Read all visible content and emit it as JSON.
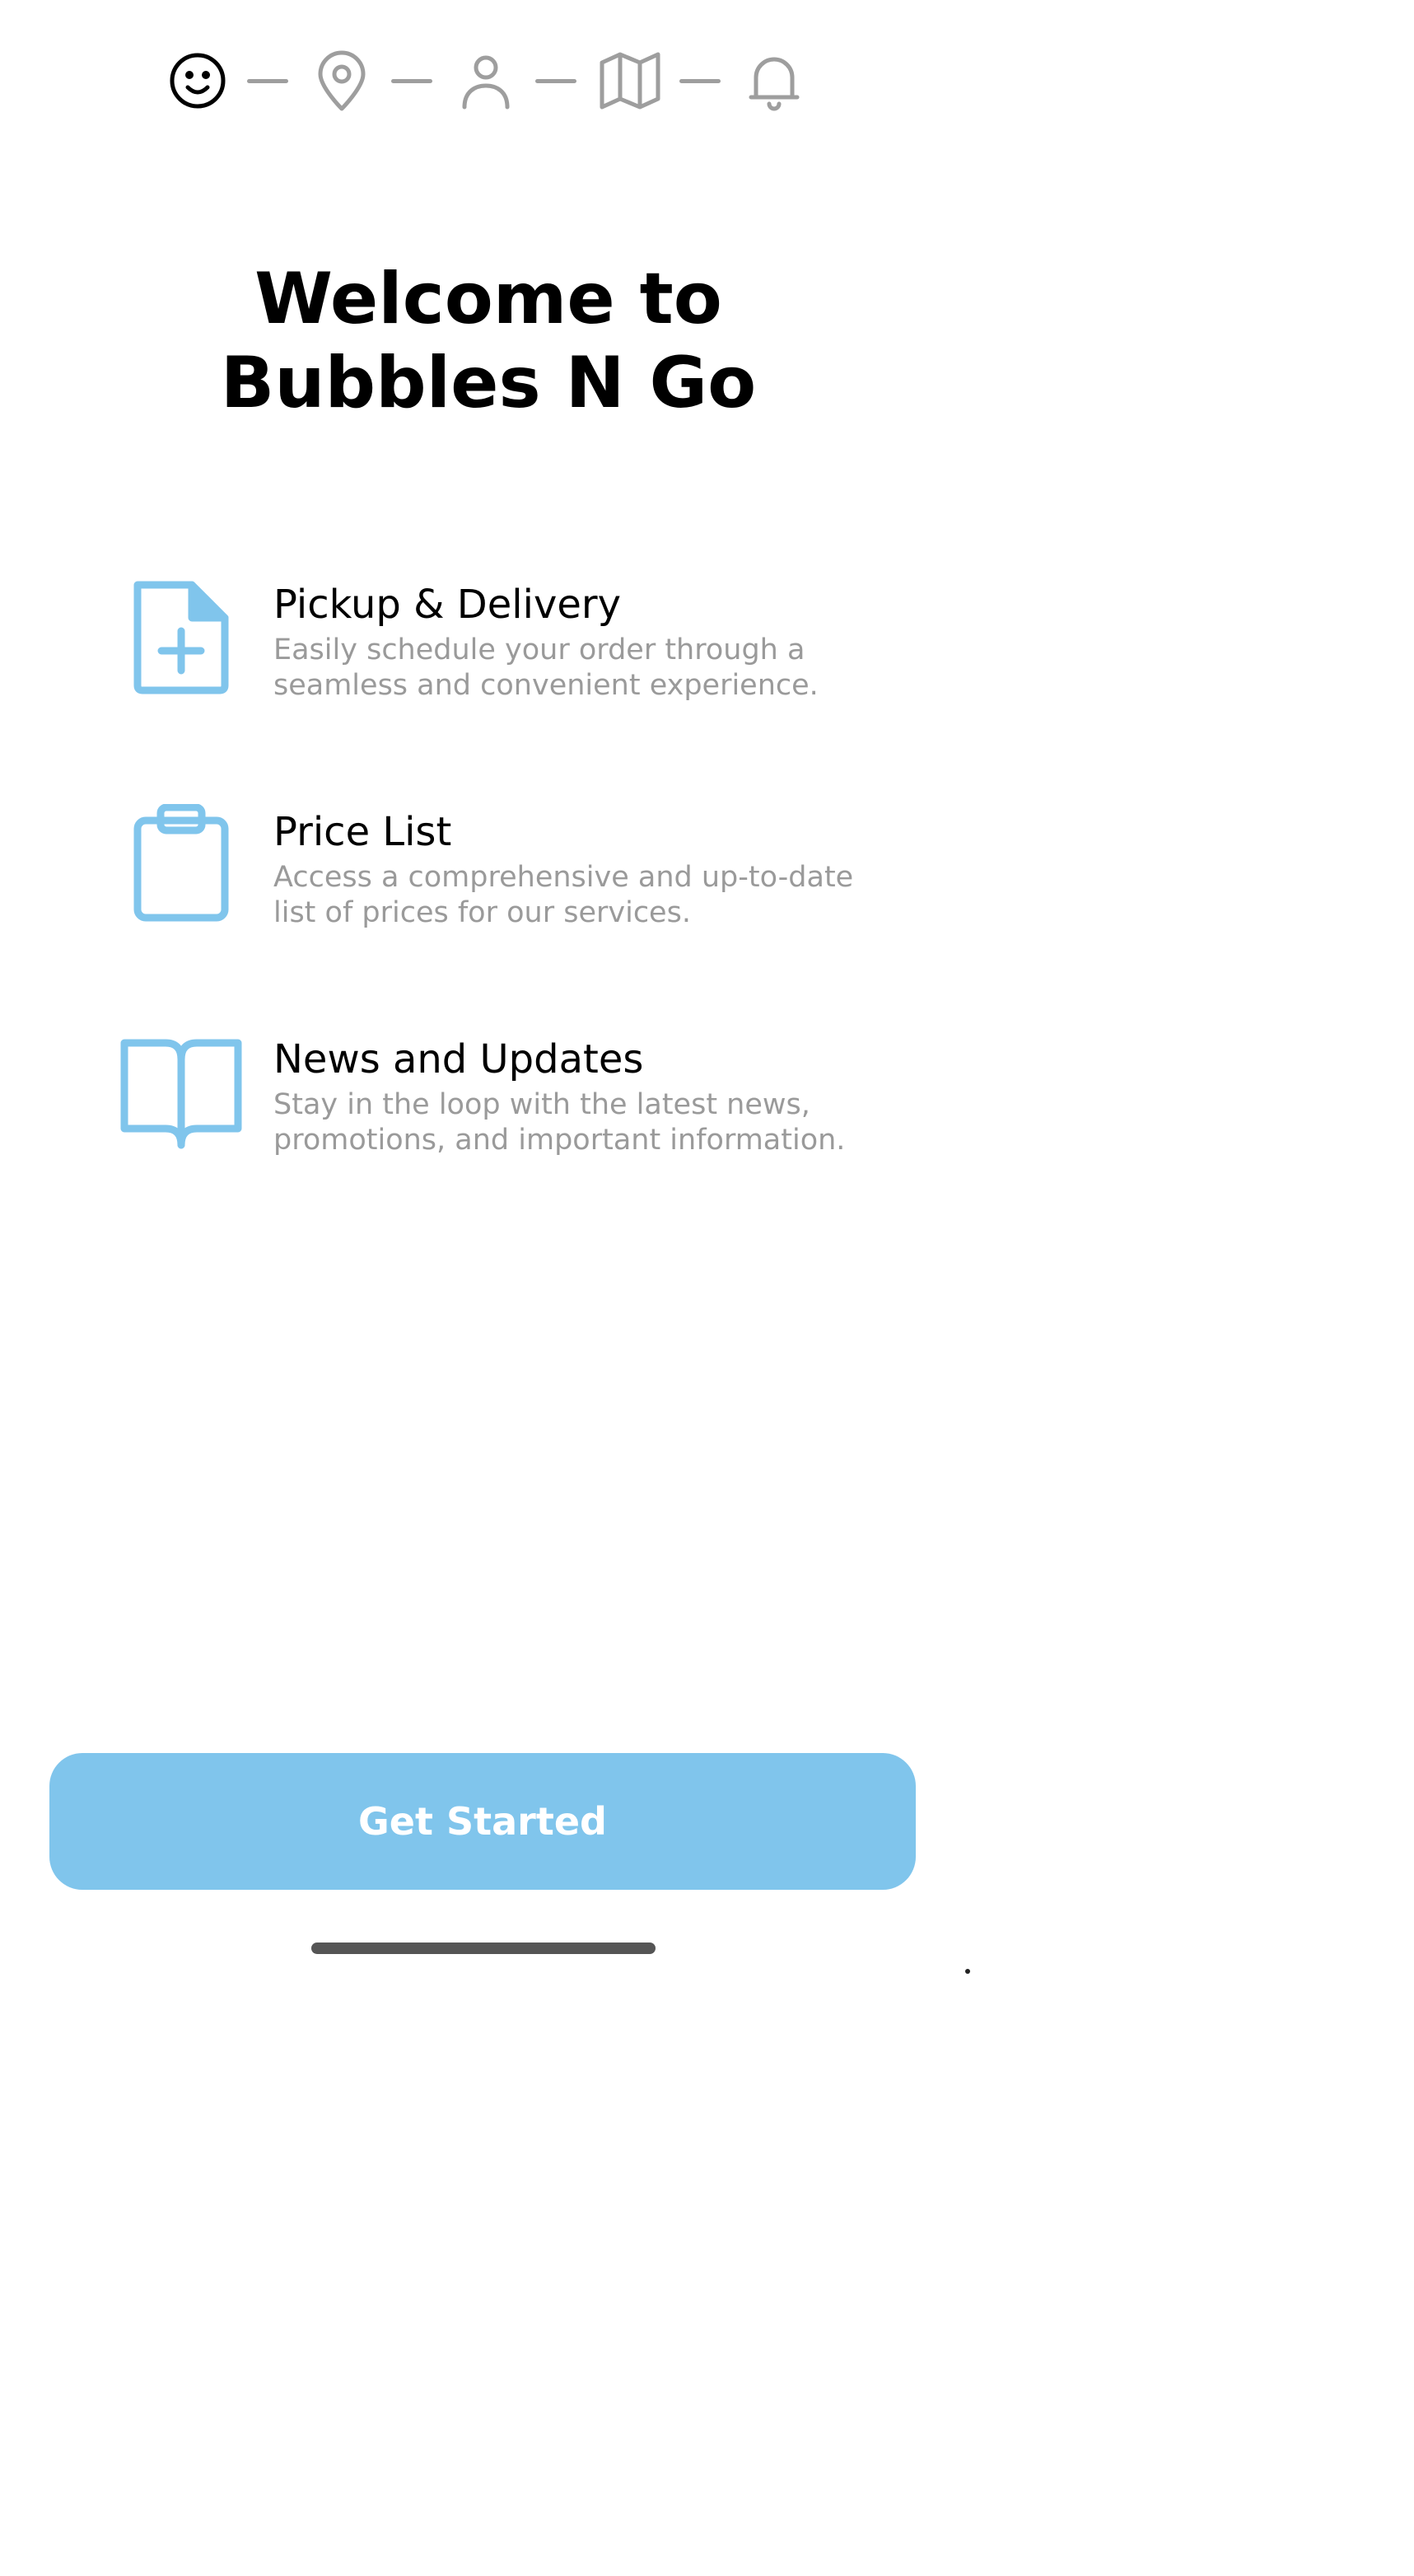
{
  "stepper": {
    "steps": [
      {
        "icon": "smiley-icon",
        "active": true
      },
      {
        "icon": "location-pin-icon",
        "active": false
      },
      {
        "icon": "user-icon",
        "active": false
      },
      {
        "icon": "map-icon",
        "active": false
      },
      {
        "icon": "bell-icon",
        "active": false
      }
    ],
    "active_color": "#000000",
    "inactive_color": "#9e9e9e"
  },
  "title": "Welcome to\nBubbles N Go",
  "features": [
    {
      "icon": "file-plus-icon",
      "title": "Pickup & Delivery",
      "description": "Easily schedule your order through a seamless and convenient experience."
    },
    {
      "icon": "clipboard-icon",
      "title": "Price List",
      "description": "Access a comprehensive and up-to-date list of prices for our services."
    },
    {
      "icon": "book-open-icon",
      "title": "News and Updates",
      "description": "Stay in the loop with the latest news, promotions, and important information."
    }
  ],
  "cta": {
    "label": "Get Started"
  },
  "colors": {
    "accent": "#80c5ec",
    "muted_text": "#9a9a9a",
    "icon_blue": "#80c5ec"
  }
}
